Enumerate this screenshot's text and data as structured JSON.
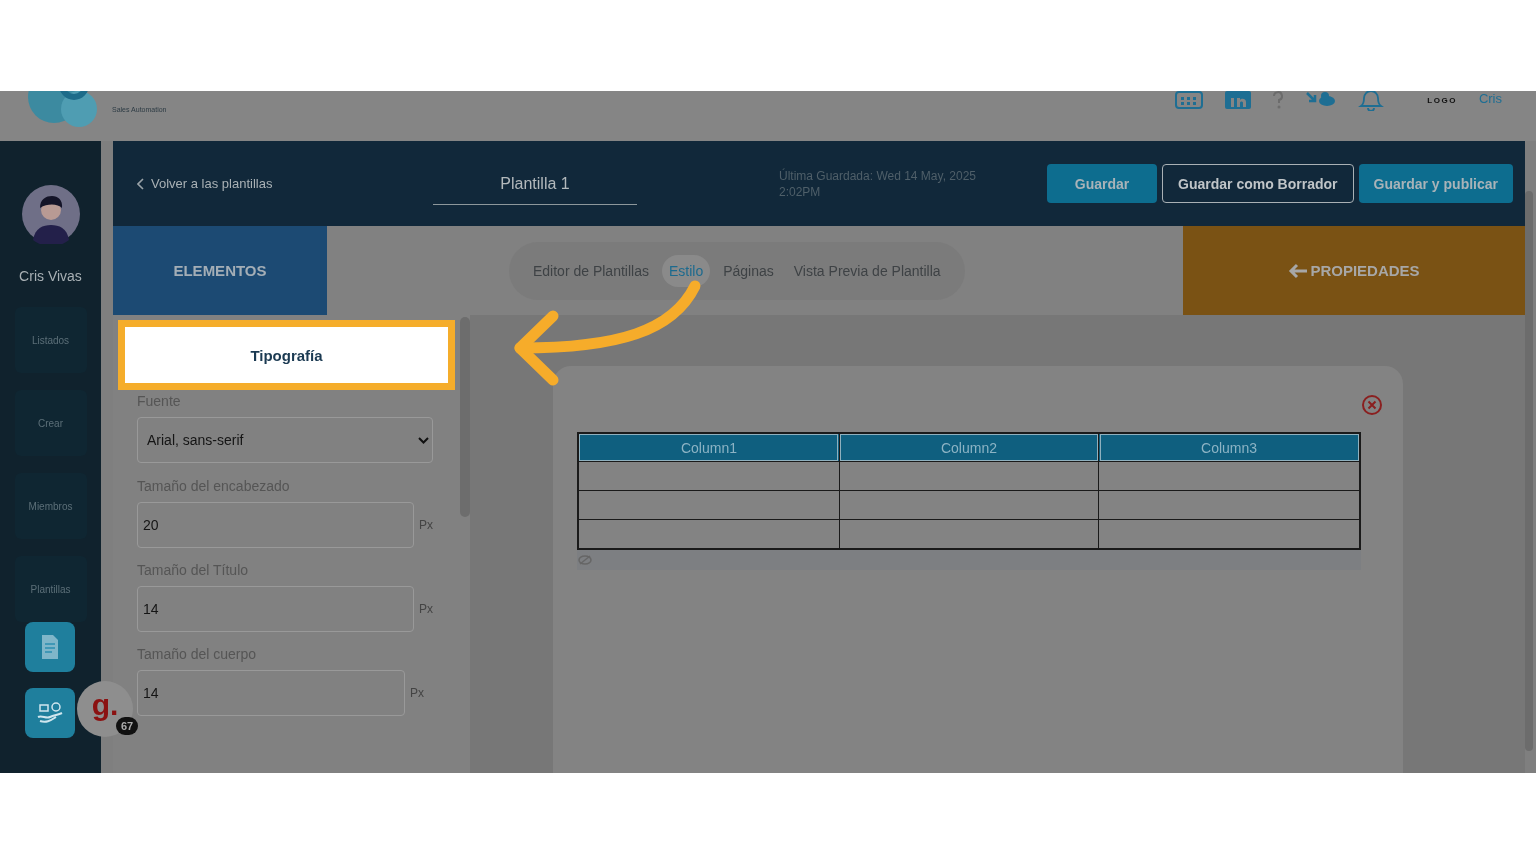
{
  "top_bar": {
    "brand_tagline": "Sales Automation",
    "logo_text": "LOGO",
    "user_name": "Cris"
  },
  "sidebar": {
    "user_name": "Cris Vivas",
    "items": [
      "Listados",
      "Crear",
      "Miembros",
      "Plantillas"
    ]
  },
  "header": {
    "back_link": "Volver a las plantillas",
    "title": "Plantilla 1",
    "last_saved": "Última Guardada: Wed 14 May, 2025 2:02PM",
    "buttons": [
      {
        "label": "Guardar",
        "kind": "primary"
      },
      {
        "label": "Guardar como Borrador",
        "kind": "outline"
      },
      {
        "label": "Guardar y publicar",
        "kind": "primary"
      }
    ]
  },
  "elements_label": "ELEMENTOS",
  "tabs": [
    {
      "label": "Editor de Plantillas",
      "selected": false
    },
    {
      "label": "Estilo",
      "selected": true
    },
    {
      "label": "Páginas",
      "selected": false
    },
    {
      "label": "Vista Previa de Plantilla",
      "selected": false
    }
  ],
  "properties_label": "PROPIEDADES",
  "typography": {
    "title": "Tipografía",
    "font_label": "Fuente",
    "font_value": "Arial, sans-serif",
    "sizes": [
      {
        "label": "Tamaño del encabezado",
        "value": "20",
        "unit": "Px"
      },
      {
        "label": "Tamaño del Título",
        "value": "14",
        "unit": "Px"
      },
      {
        "label": "Tamaño del cuerpo",
        "value": "14",
        "unit": "Px"
      }
    ]
  },
  "table": {
    "columns": [
      "Column1",
      "Column2",
      "Column3"
    ]
  },
  "widget": {
    "glyph": "g.",
    "count": "67"
  }
}
